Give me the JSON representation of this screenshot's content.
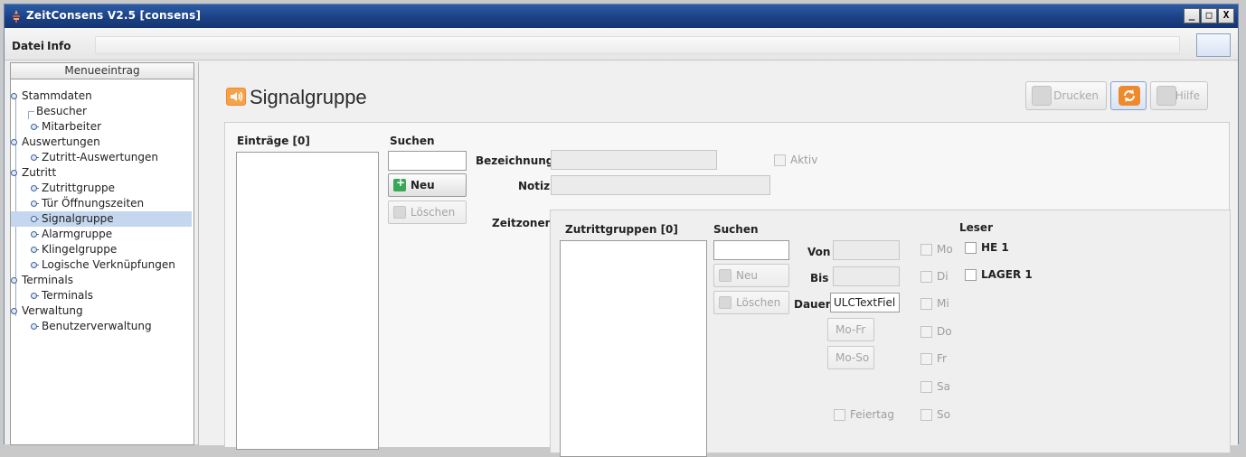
{
  "window": {
    "title": "ZeitConsens V2.5 [consens]",
    "controls": {
      "minimize": "_",
      "maximize": "□",
      "close": "X"
    }
  },
  "menu": {
    "items": [
      "Datei",
      "Info"
    ]
  },
  "sidebar": {
    "header": "Menueeintrag",
    "items": [
      {
        "label": "Stammdaten",
        "level": 0,
        "expanded": true
      },
      {
        "label": "Besucher",
        "level": 1,
        "leaf": true
      },
      {
        "label": "Mitarbeiter",
        "level": 1
      },
      {
        "label": "Auswertungen",
        "level": 0,
        "expanded": true
      },
      {
        "label": "Zutritt-Auswertungen",
        "level": 1
      },
      {
        "label": "Zutritt",
        "level": 0,
        "expanded": true
      },
      {
        "label": "Zutrittgruppe",
        "level": 1
      },
      {
        "label": "Tür Öffnungszeiten",
        "level": 1
      },
      {
        "label": "Signalgruppe",
        "level": 1,
        "selected": true
      },
      {
        "label": "Alarmgruppe",
        "level": 1
      },
      {
        "label": "Klingelgruppe",
        "level": 1
      },
      {
        "label": "Logische Verknüpfungen",
        "level": 1
      },
      {
        "label": "Terminals",
        "level": 0,
        "expanded": true
      },
      {
        "label": "Terminals",
        "level": 1
      },
      {
        "label": "Verwaltung",
        "level": 0,
        "expanded": true
      },
      {
        "label": "Benutzerverwaltung",
        "level": 1
      }
    ]
  },
  "page": {
    "title": "Signalgruppe",
    "buttons": {
      "print": "Drucken",
      "help": "Hilfe"
    }
  },
  "entries": {
    "label": "Einträge [0]",
    "search_label": "Suchen",
    "search_value": "",
    "new_button": "Neu",
    "delete_button": "Löschen"
  },
  "form": {
    "bezeichnung_label": "Bezeichnung",
    "bezeichnung_value": "",
    "notiz_label": "Notiz",
    "notiz_value": "",
    "aktiv_label": "Aktiv",
    "zeitzonen_label": "Zeitzonen"
  },
  "zeitzonen": {
    "groups_label": "Zutrittgruppen [0]",
    "search_label": "Suchen",
    "search_value": "",
    "new_button": "Neu",
    "delete_button": "Löschen",
    "von_label": "Von",
    "von_value": "",
    "bis_label": "Bis",
    "bis_value": "",
    "dauer_label": "Dauer",
    "dauer_value": "ULCTextFiel",
    "mofr_button": "Mo-Fr",
    "moso_button": "Mo-So",
    "feiertag_label": "Feiertag",
    "days": [
      "Mo",
      "Di",
      "Mi",
      "Do",
      "Fr",
      "Sa",
      "So"
    ]
  },
  "leser": {
    "label": "Leser",
    "readers": [
      "HE 1",
      "LAGER 1"
    ]
  }
}
